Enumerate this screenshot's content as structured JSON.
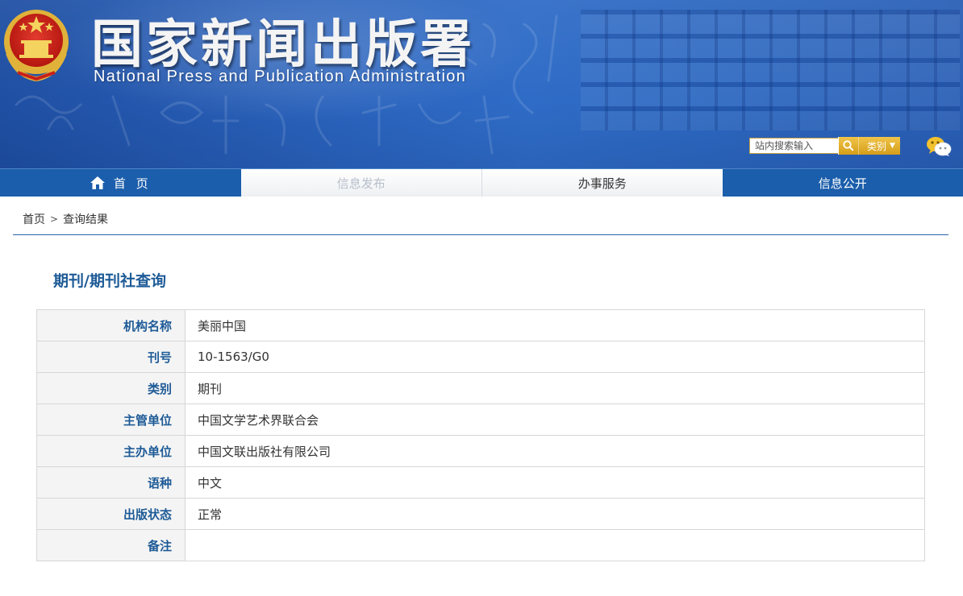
{
  "header": {
    "title": "国家新闻出版署",
    "subtitle": "National  Press and Publication Administration",
    "search": {
      "placeholder": "站内搜索输入",
      "category_label": "类别"
    }
  },
  "nav": {
    "items": [
      {
        "label": "首 页"
      },
      {
        "label": "信息发布"
      },
      {
        "label": "办事服务"
      },
      {
        "label": "信息公开"
      }
    ]
  },
  "breadcrumb": {
    "home": "首页",
    "separator": ">",
    "current": "查询结果"
  },
  "section": {
    "title": "期刊/期刊社查询"
  },
  "details": [
    {
      "label": "机构名称",
      "value": "美丽中国"
    },
    {
      "label": "刊号",
      "value": "10-1563/G0"
    },
    {
      "label": "类别",
      "value": "期刊"
    },
    {
      "label": "主管单位",
      "value": "中国文学艺术界联合会"
    },
    {
      "label": "主办单位",
      "value": "中国文联出版社有限公司"
    },
    {
      "label": "语种",
      "value": "中文"
    },
    {
      "label": "出版状态",
      "value": "正常"
    },
    {
      "label": "备注",
      "value": ""
    }
  ],
  "colors": {
    "nav_blue": "#1b5eab",
    "label_blue": "#1e5b97",
    "search_gold": "#e2ad2c"
  }
}
